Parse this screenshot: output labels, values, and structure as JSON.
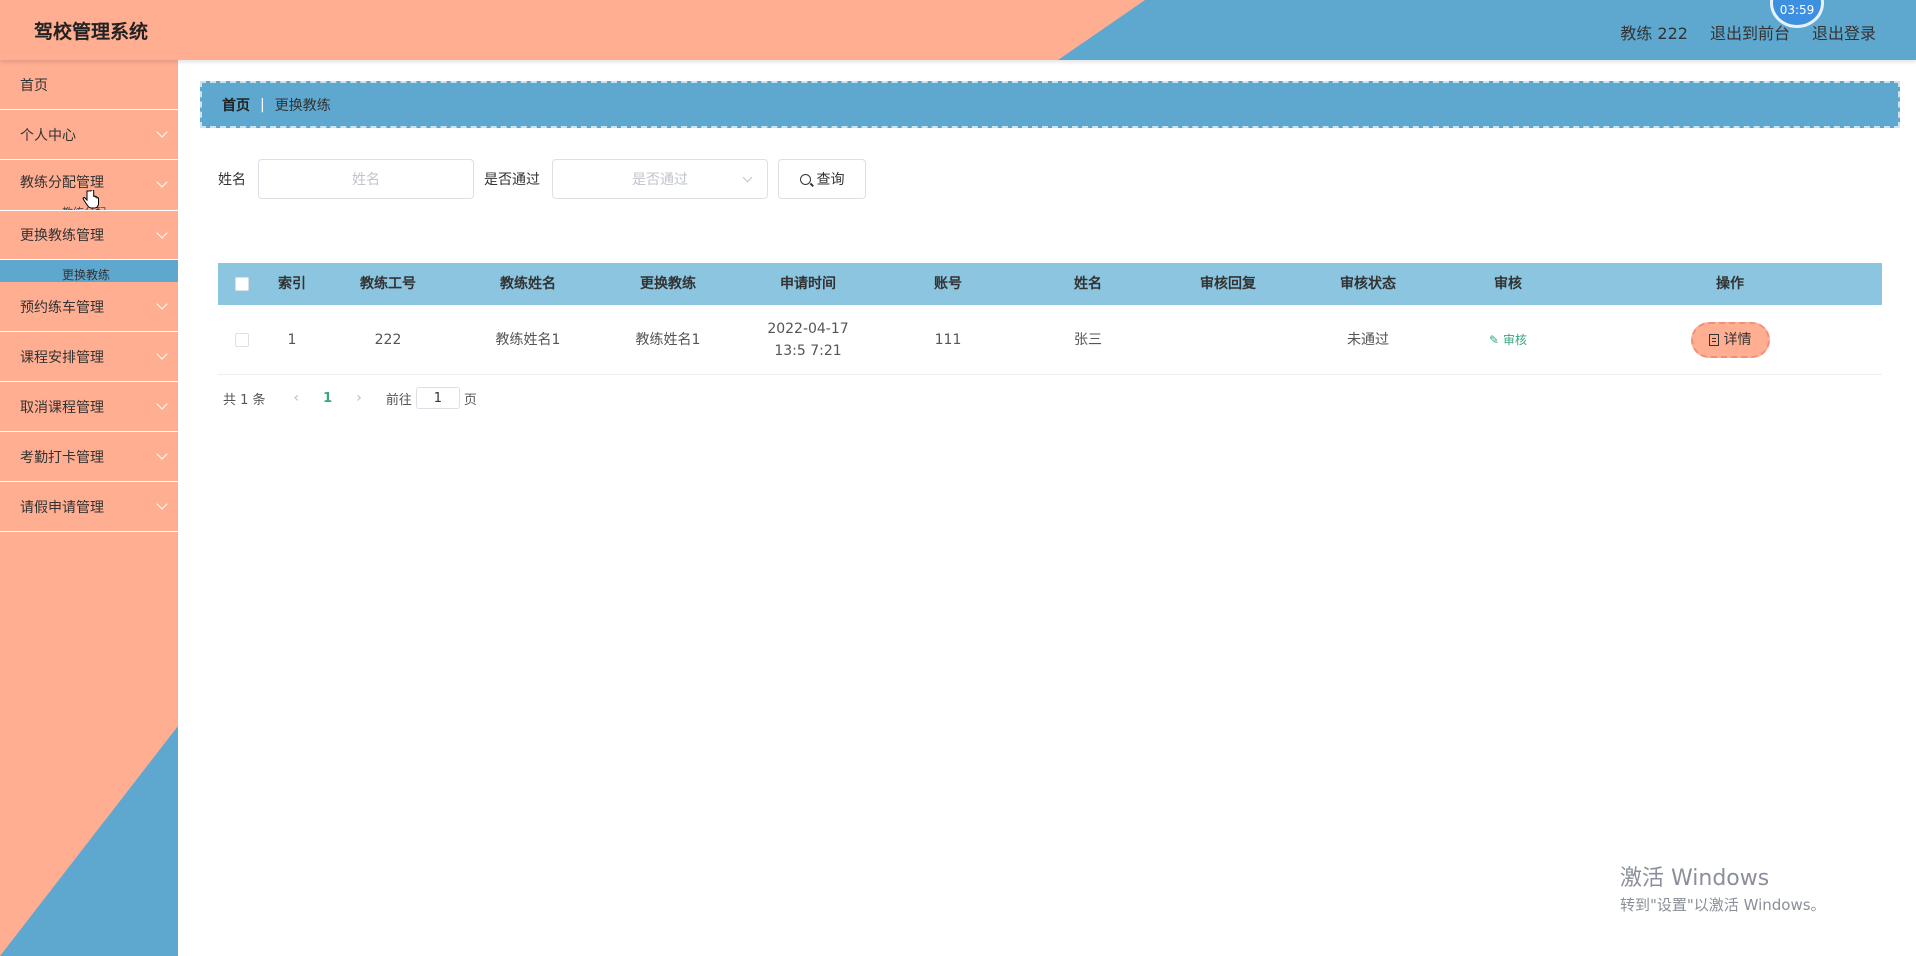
{
  "header": {
    "title": "驾校管理系统",
    "clock": "03:59",
    "user": "教练 222",
    "to_front": "退出到前台",
    "logout": "退出登录"
  },
  "sidebar": {
    "items": [
      {
        "label": "首页"
      },
      {
        "label": "个人中心"
      },
      {
        "label": "教练分配管理"
      },
      {
        "label": "更换教练管理"
      },
      {
        "label": "预约练车管理"
      },
      {
        "label": "课程安排管理"
      },
      {
        "label": "取消课程管理"
      },
      {
        "label": "考勤打卡管理"
      },
      {
        "label": "请假申请管理"
      }
    ],
    "sub_partial_1": "教练分配",
    "sub_active": "更换教练"
  },
  "breadcrumb": {
    "home": "首页",
    "separator": "|",
    "current": "更换教练"
  },
  "filter": {
    "name_label": "姓名",
    "name_placeholder": "姓名",
    "pass_label": "是否通过",
    "pass_placeholder": "是否通过",
    "query_label": "查询"
  },
  "table": {
    "headers": [
      "索引",
      "教练工号",
      "教练姓名",
      "更换教练",
      "申请时间",
      "账号",
      "姓名",
      "审核回复",
      "审核状态",
      "审核",
      "操作"
    ],
    "rows": [
      {
        "index": "1",
        "coach_no": "222",
        "coach_name": "教练姓名1",
        "new_coach": "教练姓名1",
        "apply_time": "2022-04-17 13:5 7:21",
        "account": "111",
        "name": "张三",
        "reply": "",
        "status": "未通过",
        "audit": "审核",
        "action": "详情"
      }
    ]
  },
  "pager": {
    "total": "共 1 条",
    "prev": "‹",
    "current": "1",
    "next": "›",
    "goto_label": "前往",
    "goto_value": "1",
    "page_suffix": "页"
  },
  "watermark": {
    "line1": "激活 Windows",
    "line2": "转到\"设置\"以激活 Windows。"
  },
  "colors": {
    "salmon": "#ffae91",
    "blue": "#5ea8d0",
    "table_header": "#8cc5df",
    "green": "#3aa57f"
  }
}
